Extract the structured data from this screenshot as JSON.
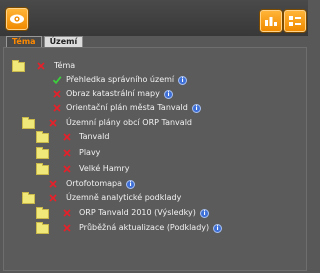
{
  "toolbar": {
    "left_icon": "eye-icon",
    "right_icons": [
      "layers-chart-icon",
      "legend-icon"
    ]
  },
  "tabs": [
    {
      "label": "Téma",
      "active": true
    },
    {
      "label": "Území",
      "active": false
    }
  ],
  "colors": {
    "accent": "#ff8a00",
    "mark_off": "#e8202a",
    "mark_on": "#3ccf3c",
    "info": "#3d6fd6",
    "folder": "#f1e87a"
  },
  "tree": [
    {
      "label": "Téma",
      "folder": true,
      "checked": false,
      "info": false
    },
    {
      "label": "Přehledka správního území",
      "folder": false,
      "checked": true,
      "info": true
    },
    {
      "label": "Obraz katastrální mapy",
      "folder": false,
      "checked": false,
      "info": true
    },
    {
      "label": "Orientační plán města Tanvald",
      "folder": false,
      "checked": false,
      "info": true
    },
    {
      "label": "Územní plány obcí ORP Tanvald",
      "folder": true,
      "checked": false,
      "info": false
    },
    {
      "label": "Tanvald",
      "folder": true,
      "checked": false,
      "info": false
    },
    {
      "label": "Plavy",
      "folder": true,
      "checked": false,
      "info": false
    },
    {
      "label": "Velké Hamry",
      "folder": true,
      "checked": false,
      "info": false
    },
    {
      "label": "Ortofotomapa",
      "folder": false,
      "checked": false,
      "info": true
    },
    {
      "label": "Územně analytické podklady",
      "folder": true,
      "checked": false,
      "info": false
    },
    {
      "label": "ORP Tanvald 2010 (Výsledky)",
      "folder": true,
      "checked": false,
      "info": true
    },
    {
      "label": "Průběžná aktualizace (Podklady)",
      "folder": true,
      "checked": false,
      "info": true
    }
  ]
}
